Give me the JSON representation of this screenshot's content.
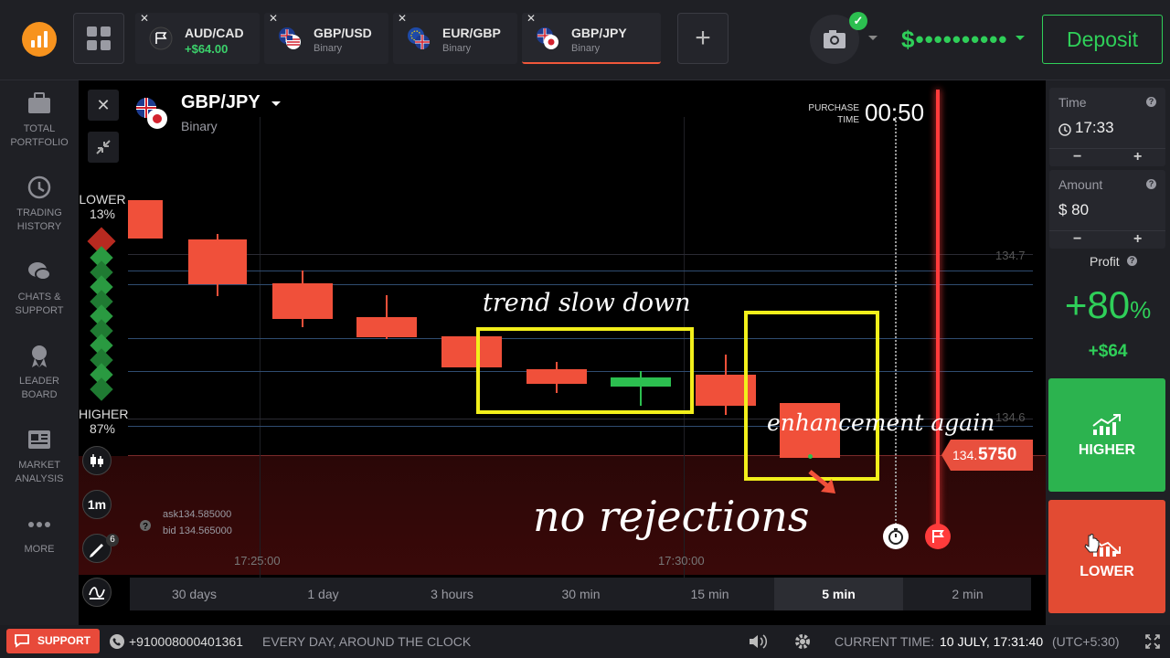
{
  "topbar": {
    "tabs": [
      {
        "name": "AUD/CAD",
        "sub": "+$64.00"
      },
      {
        "name": "GBP/USD",
        "sub": "Binary"
      },
      {
        "name": "EUR/GBP",
        "sub": "Binary"
      },
      {
        "name": "GBP/JPY",
        "sub": "Binary"
      }
    ],
    "balance": "$••••••••••",
    "deposit": "Deposit"
  },
  "sidebar": {
    "items": [
      {
        "label1": "TOTAL",
        "label2": "PORTFOLIO"
      },
      {
        "label1": "TRADING",
        "label2": "HISTORY"
      },
      {
        "label1": "CHATS &",
        "label2": "SUPPORT"
      },
      {
        "label1": "LEADER",
        "label2": "BOARD"
      },
      {
        "label1": "MARKET",
        "label2": "ANALYSIS"
      },
      {
        "label1": "MORE",
        "label2": ""
      }
    ]
  },
  "chart": {
    "asset": "GBP/JPY",
    "asset_type": "Binary",
    "purchase_time_label1": "PURCHASE",
    "purchase_time_label2": "TIME",
    "purchase_countdown": "00:50",
    "lower_label": "LOWER",
    "lower_pct": "13%",
    "higher_label": "HIGHER",
    "higher_pct": "87%",
    "price_levels": [
      "134.7",
      "134.6"
    ],
    "current_price_prefix": "134.",
    "current_price_suffix": "5750",
    "ask": "ask134.585000",
    "bid": "bid 134.565000",
    "time_labels": [
      "17:25:00",
      "17:30:00"
    ],
    "timeframe": "1m",
    "tool_badge": "6",
    "annotations": {
      "trend": "trend slow down",
      "enhancement": "enhancement again",
      "rejections": "no rejections"
    },
    "periods": [
      "30 days",
      "1 day",
      "3 hours",
      "30 min",
      "15 min",
      "5 min",
      "2 min"
    ],
    "active_period": "5 min"
  },
  "panel": {
    "time_label": "Time",
    "time_value": "17:33",
    "amount_label": "Amount",
    "amount_value": "$ 80",
    "profit_label": "Profit",
    "profit_pct": "+80",
    "profit_pct_sign": "%",
    "profit_amount": "+$64",
    "higher_button": "HIGHER",
    "lower_button": "LOWER"
  },
  "bottombar": {
    "support": "SUPPORT",
    "phone": "+910008000401361",
    "hours": "EVERY DAY, AROUND THE CLOCK",
    "current_time_label": "CURRENT TIME:",
    "current_time_value": "10 JULY, 17:31:40",
    "timezone": "(UTC+5:30)"
  },
  "colors": {
    "green": "#2fcf59",
    "red": "#f0503a",
    "accent_yellow": "#f2ef1b",
    "orange_logo": "#f7931e"
  }
}
